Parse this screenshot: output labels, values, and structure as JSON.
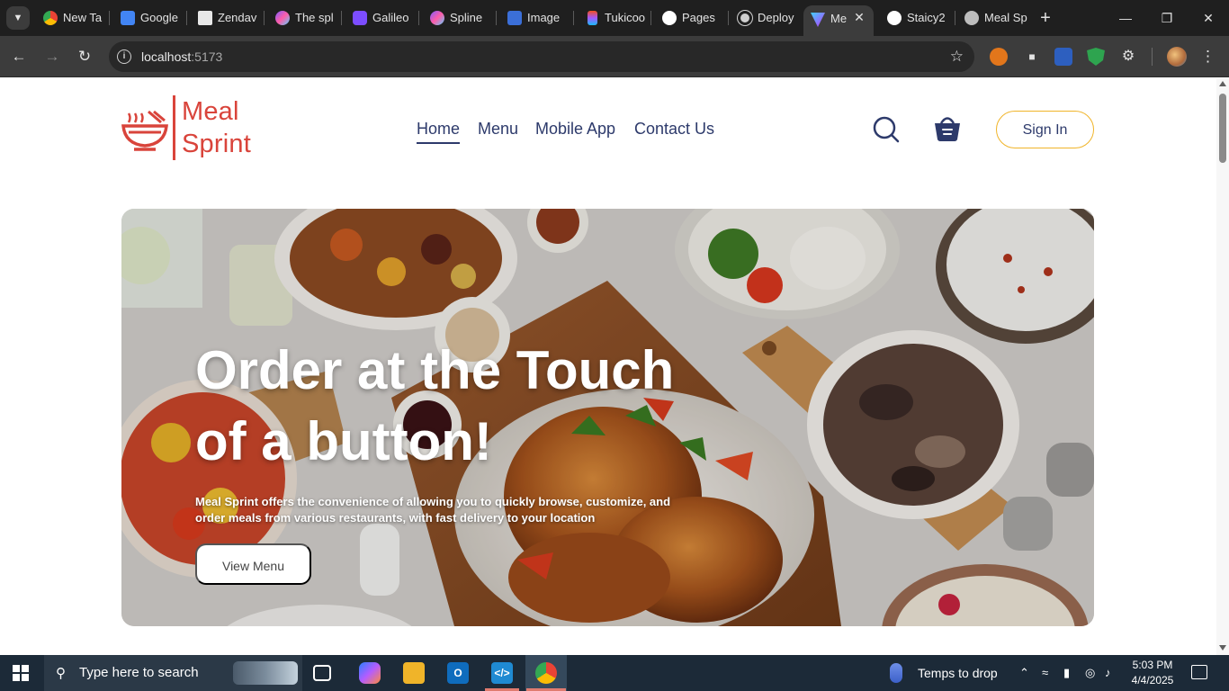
{
  "browser": {
    "tabs": [
      {
        "label": "New Ta",
        "icon": "chrome-icon"
      },
      {
        "label": "Google",
        "icon": "google-docs-icon"
      },
      {
        "label": "Zendav",
        "icon": "zendesk-icon"
      },
      {
        "label": "The spl",
        "icon": "spline-icon"
      },
      {
        "label": "Galileo",
        "icon": "galileo-icon"
      },
      {
        "label": "Spline",
        "icon": "spline-icon"
      },
      {
        "label": "Image",
        "icon": "image-icon"
      },
      {
        "label": "Tukicoo",
        "icon": "figma-icon"
      },
      {
        "label": "Pages",
        "icon": "github-icon"
      },
      {
        "label": "Deploy",
        "icon": "deploy-icon"
      },
      {
        "label": "Me",
        "icon": "vite-icon"
      },
      {
        "label": "Staicy2",
        "icon": "github-icon"
      },
      {
        "label": "Meal Sp",
        "icon": "globe-icon"
      }
    ],
    "active_tab_index": 10,
    "address": {
      "host": "localhost",
      "port": ":5173"
    }
  },
  "site": {
    "logo_line1": "Meal",
    "logo_line2": "Sprint",
    "nav": [
      {
        "label": "Home",
        "active": true
      },
      {
        "label": "Menu",
        "active": false
      },
      {
        "label": "Mobile App",
        "active": false
      },
      {
        "label": "Contact Us",
        "active": false
      }
    ],
    "sign_in": "Sign In",
    "colors": {
      "brand": "#d9443b",
      "nav": "#2d3a6b",
      "sign_in_border": "#f0b429"
    }
  },
  "hero": {
    "title_line1": "Order at the Touch",
    "title_line2": "of a button!",
    "subtitle": "Meal Sprint offers the convenience of allowing you to quickly browse, customize, and order meals from various restaurants, with fast delivery to your location",
    "cta": "View Menu"
  },
  "taskbar": {
    "search_placeholder": "Type here to search",
    "weather": "Temps to drop",
    "time": "5:03 PM",
    "date": "4/4/2025"
  }
}
